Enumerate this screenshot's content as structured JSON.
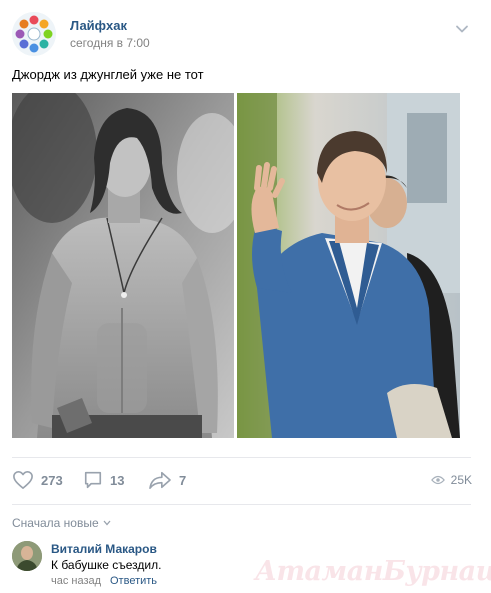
{
  "post": {
    "author": "Лайфхак",
    "time": "сегодня в 7:00",
    "text": "Джордж из джунглей уже не тот"
  },
  "actions": {
    "likes": "273",
    "comments": "13",
    "shares": "7",
    "views": "25K"
  },
  "comments_section": {
    "sort_label": "Сначала новые"
  },
  "comment": {
    "author": "Виталий Макаров",
    "text": "К бабушке съездил.",
    "time": "час назад",
    "reply_label": "Ответить"
  },
  "watermark": "АтаманБурнаш для ЯП",
  "colors": {
    "link": "#2a5885",
    "muted": "#818c99",
    "divider": "#e7e8ec"
  },
  "icons": [
    "community-logo-icon",
    "chevron-down-icon",
    "heart-icon",
    "comment-icon",
    "share-arrow-icon",
    "eye-icon"
  ]
}
